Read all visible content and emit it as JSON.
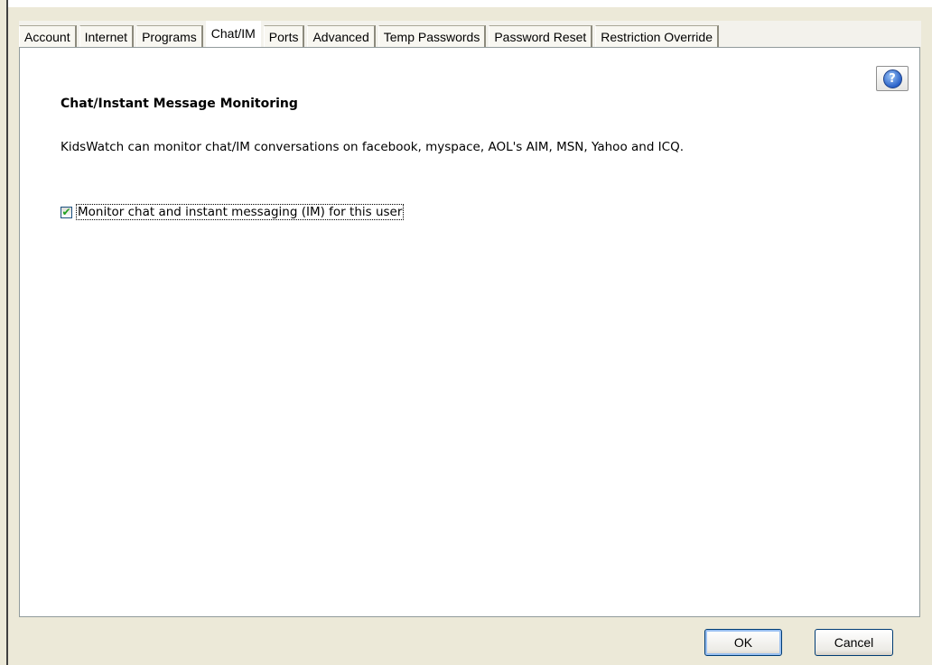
{
  "tabs": [
    {
      "label": "Account",
      "active": false
    },
    {
      "label": "Internet",
      "active": false
    },
    {
      "label": "Programs",
      "active": false
    },
    {
      "label": "Chat/IM",
      "active": true
    },
    {
      "label": "Ports",
      "active": false
    },
    {
      "label": "Advanced",
      "active": false
    },
    {
      "label": "Temp Passwords",
      "active": false
    },
    {
      "label": "Password Reset",
      "active": false
    },
    {
      "label": "Restriction Override",
      "active": false
    }
  ],
  "panel": {
    "heading": "Chat/Instant Message Monitoring",
    "description": "KidsWatch can monitor chat/IM conversations on facebook, myspace, AOL's AIM, MSN, Yahoo and ICQ.",
    "monitor_checkbox": {
      "label": "Monitor chat and instant messaging (IM) for this user",
      "checked": true
    },
    "help_icon": "help-question-icon"
  },
  "buttons": {
    "ok_label": "OK",
    "cancel_label": "Cancel"
  }
}
